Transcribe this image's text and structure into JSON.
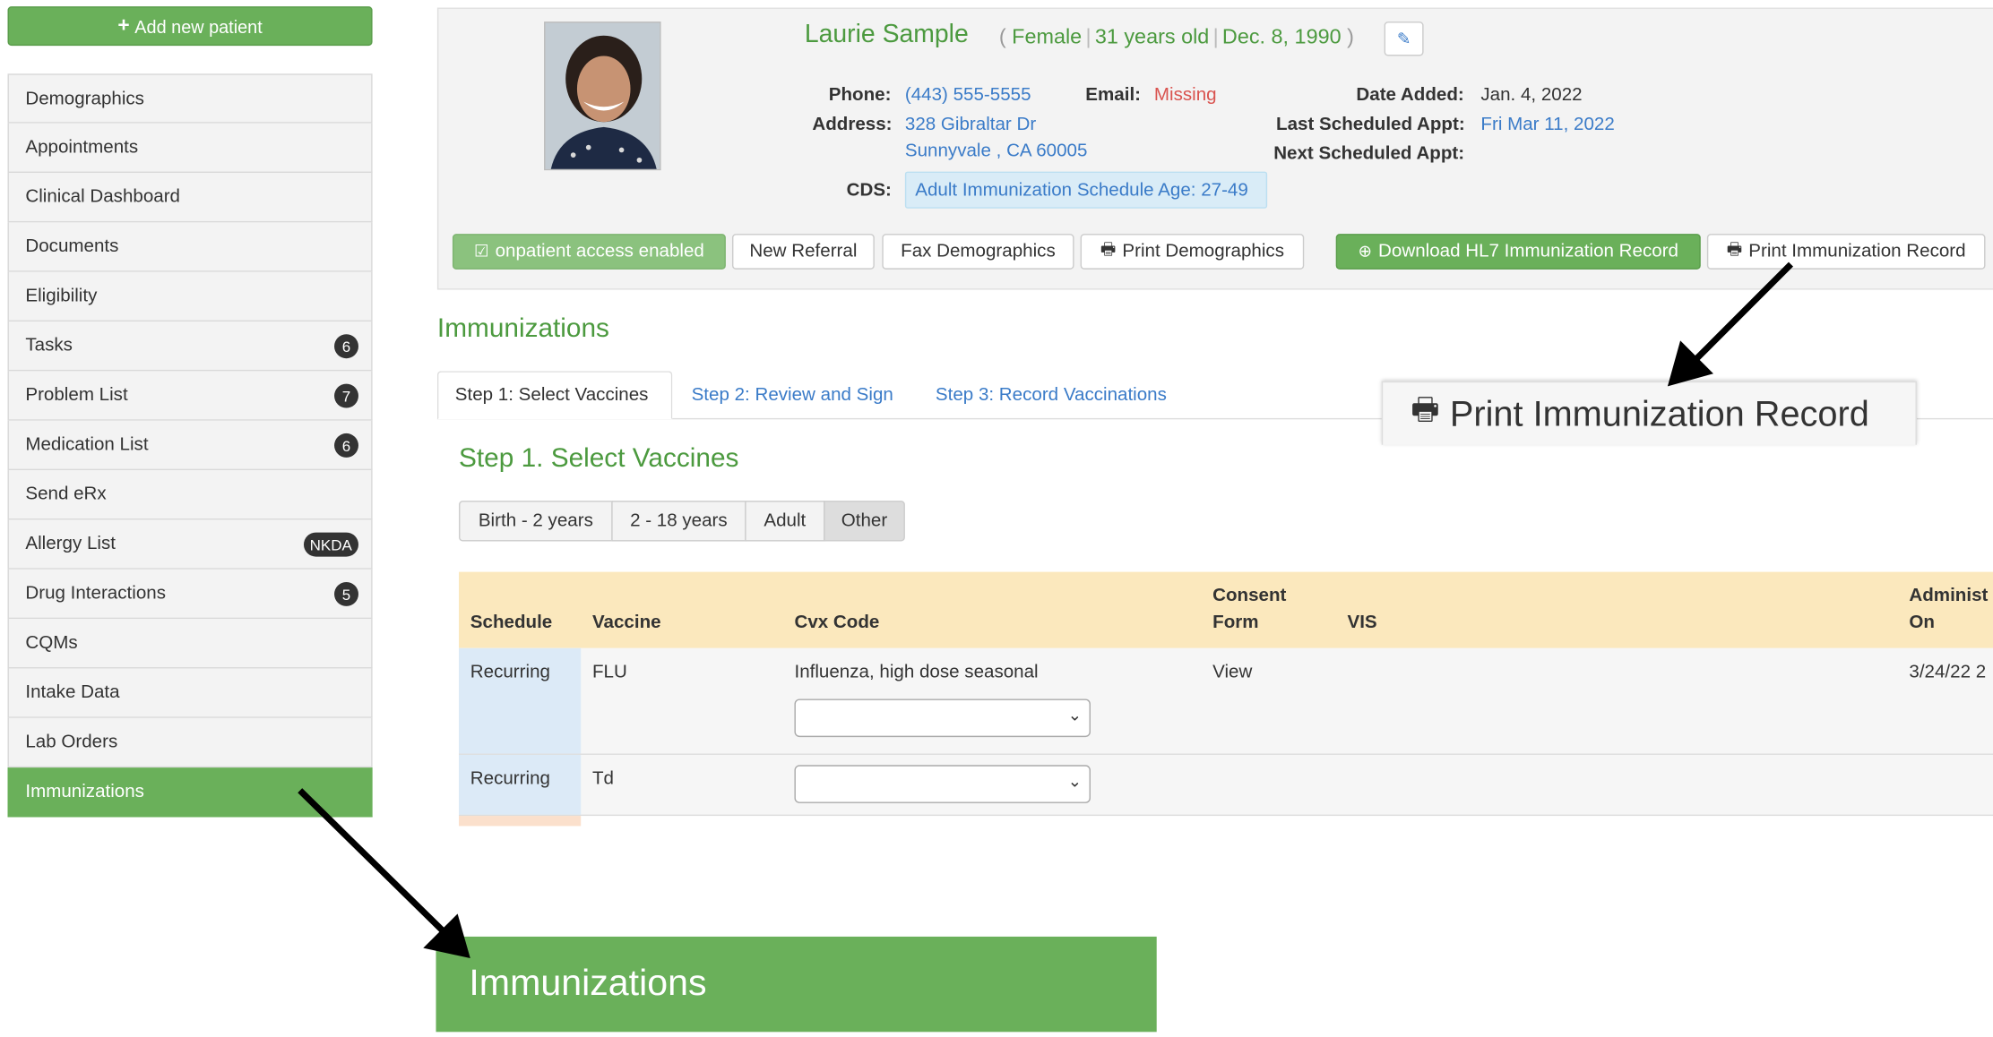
{
  "sidebar": {
    "add_patient_label": "Add new patient",
    "items": [
      {
        "label": "Demographics",
        "badge": null
      },
      {
        "label": "Appointments",
        "badge": null
      },
      {
        "label": "Clinical Dashboard",
        "badge": null
      },
      {
        "label": "Documents",
        "badge": null
      },
      {
        "label": "Eligibility",
        "badge": null
      },
      {
        "label": "Tasks",
        "badge": "6"
      },
      {
        "label": "Problem List",
        "badge": "7"
      },
      {
        "label": "Medication List",
        "badge": "6"
      },
      {
        "label": "Send eRx",
        "badge": null
      },
      {
        "label": "Allergy List",
        "badge": "NKDA"
      },
      {
        "label": "Drug Interactions",
        "badge": "5"
      },
      {
        "label": "CQMs",
        "badge": null
      },
      {
        "label": "Intake Data",
        "badge": null
      },
      {
        "label": "Lab Orders",
        "badge": null
      },
      {
        "label": "Immunizations",
        "badge": null,
        "active": true
      }
    ]
  },
  "patient": {
    "name": "Laurie Sample",
    "gender": "Female",
    "age": "31 years old",
    "dob": "Dec. 8, 1990",
    "phone_label": "Phone:",
    "phone": "(443) 555-5555",
    "email_label": "Email:",
    "email": "Missing",
    "address_label": "Address:",
    "address_line1": "328 Gibraltar Dr",
    "address_line2": "Sunnyvale , CA 60005",
    "date_added_label": "Date Added:",
    "date_added": "Jan. 4, 2022",
    "last_appt_label": "Last Scheduled Appt:",
    "last_appt": "Fri Mar 11, 2022",
    "next_appt_label": "Next Scheduled Appt:",
    "cds_label": "CDS:",
    "cds": "Adult Immunization Schedule Age: 27-49"
  },
  "actions": {
    "onpatient": "onpatient access enabled",
    "new_referral": "New Referral",
    "fax_demographics": "Fax Demographics",
    "print_demographics": "Print Demographics",
    "download_hl7": "Download HL7 Immunization Record",
    "print_immunization": "Print Immunization Record"
  },
  "immunizations": {
    "title": "Immunizations",
    "tabs": [
      "Step 1: Select Vaccines",
      "Step 2: Review and Sign",
      "Step 3: Record Vaccinations"
    ],
    "step_title": "Step 1. Select Vaccines",
    "age_groups": [
      "Birth - 2 years",
      "2 - 18 years",
      "Adult",
      "Other"
    ],
    "selected_age_group": "Other",
    "columns": {
      "schedule": "Schedule",
      "vaccine": "Vaccine",
      "cvx": "Cvx Code",
      "consent_1": "Consent",
      "consent_2": "Form",
      "vis": "VIS",
      "admin_1": "Administ",
      "admin_2": "On"
    },
    "rows": [
      {
        "schedule": "Recurring",
        "vaccine": "FLU",
        "cvx": "Influenza, high dose seasonal",
        "consent": "View",
        "administered": "3/24/22 2"
      },
      {
        "schedule": "Recurring",
        "vaccine": "Td",
        "cvx": "",
        "consent": "",
        "administered": ""
      }
    ]
  },
  "callouts": {
    "print_zoom": "Print Immunization Record",
    "immunizations_zoom": "Immunizations"
  },
  "colors": {
    "brand_green": "#6ab05a",
    "title_green": "#4c9a3f",
    "link_blue": "#3a7bc8",
    "table_header": "#fbe8bd",
    "missing_red": "#d9534f"
  }
}
